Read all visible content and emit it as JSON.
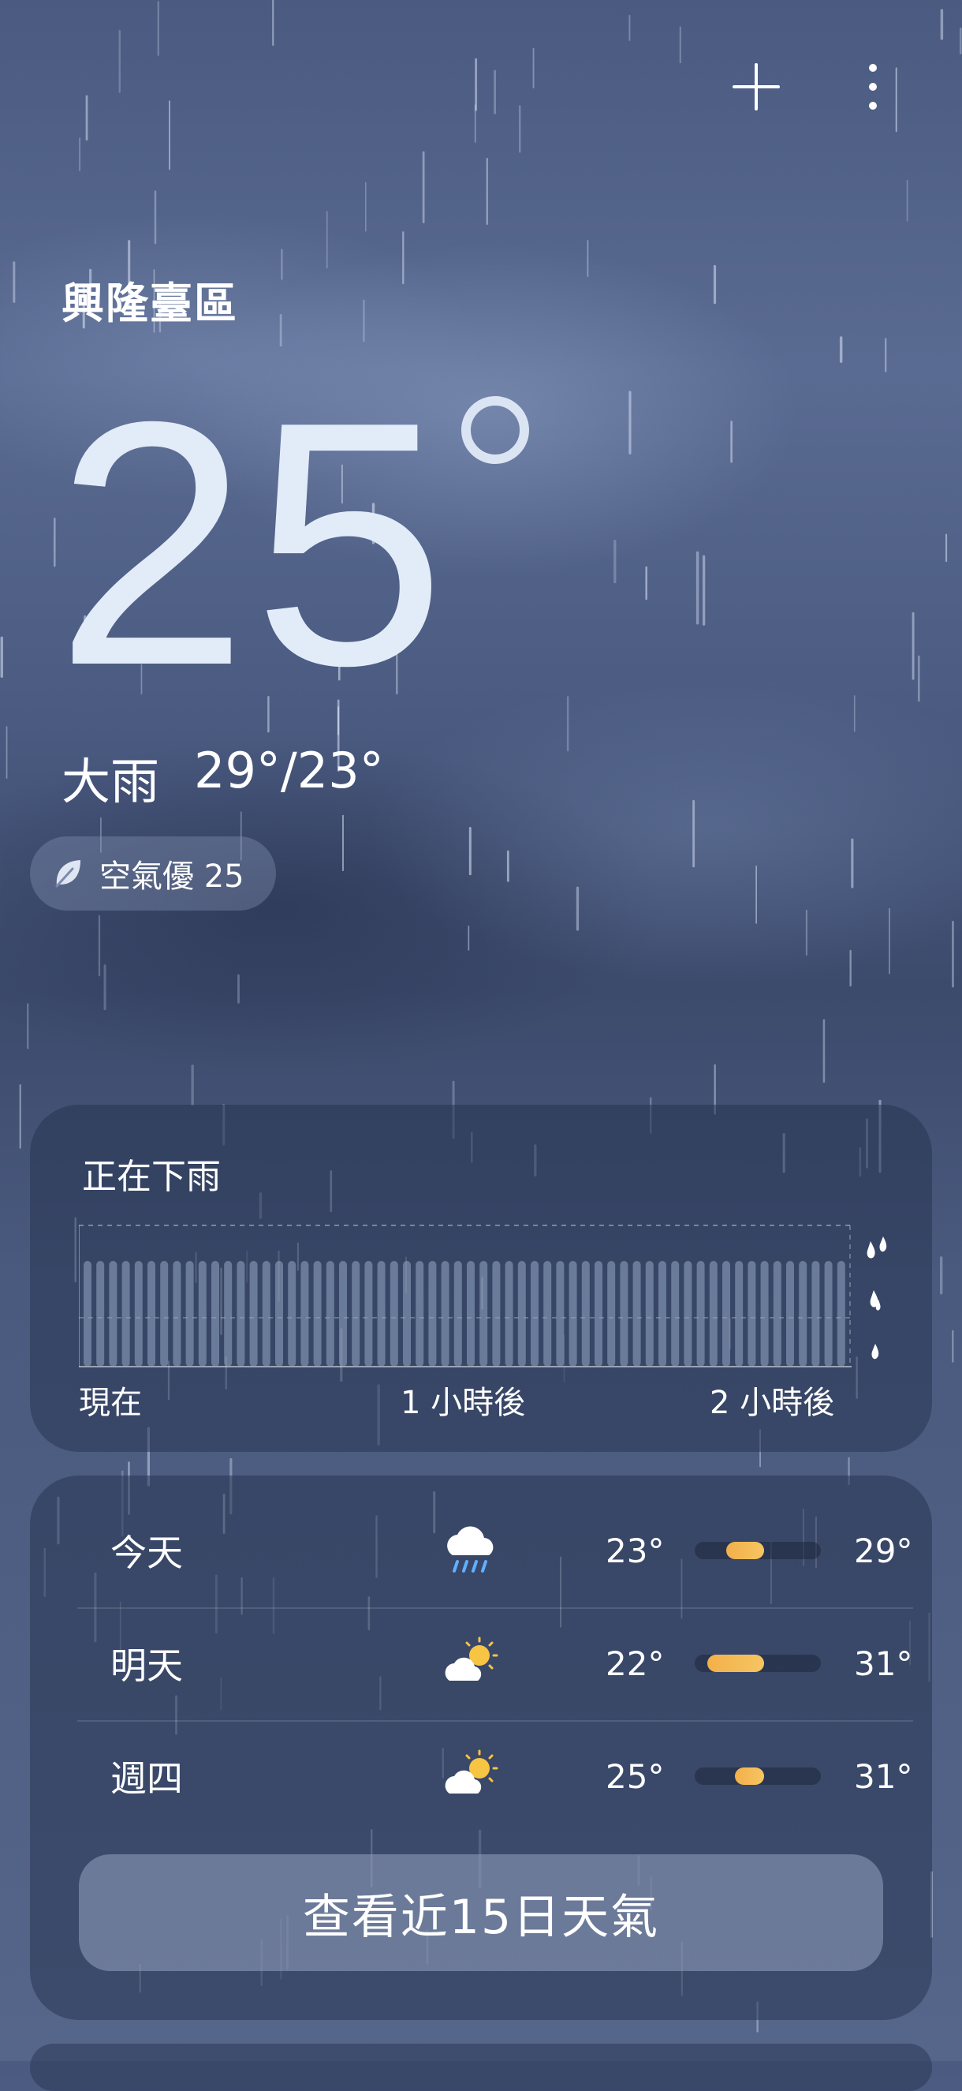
{
  "toolbar": {
    "add_icon": "plus-icon",
    "more_icon": "more-vertical-icon"
  },
  "location": {
    "name": "興隆臺區"
  },
  "current": {
    "temperature": "25",
    "condition": "大雨",
    "range": "29°/23°"
  },
  "aqi": {
    "label": "空氣優 25",
    "icon": "leaf-icon"
  },
  "precipitation": {
    "title": "正在下雨",
    "labels": [
      "現在",
      "1 小時後",
      "2 小時後"
    ],
    "intensity_icon": "raindrops-icon"
  },
  "forecast": {
    "days": [
      {
        "day": "今天",
        "icon": "heavy-rain-icon",
        "low": "23°",
        "high": "29°",
        "bar_start": 0.25,
        "bar_end": 0.55
      },
      {
        "day": "明天",
        "icon": "partly-cloudy-icon",
        "low": "22°",
        "high": "31°",
        "bar_start": 0.1,
        "bar_end": 0.55
      },
      {
        "day": "週四",
        "icon": "partly-cloudy-icon",
        "low": "25°",
        "high": "31°",
        "bar_start": 0.32,
        "bar_end": 0.55
      }
    ],
    "cta": "查看近15日天氣"
  },
  "colors": {
    "accent_bar": "#f3b04a"
  }
}
